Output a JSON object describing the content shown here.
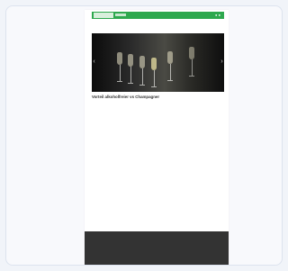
{
  "colors": {
    "page_bg": "#f1f4f9",
    "header_green": "#2ea84e",
    "footer_bg": "#333333",
    "text": "#555555"
  },
  "email": {
    "header": {
      "logo_text": "",
      "link_text": "● ●"
    },
    "hero": {
      "prev_icon": "chevron-left-icon",
      "next_icon": "chevron-right-icon",
      "prev_glyph": "‹",
      "next_glyph": "›"
    },
    "headline": "Vorteil alkoholfreier vs Champagner",
    "paragraphs": [
      "",
      "",
      "",
      "",
      "",
      "",
      ""
    ],
    "subheads": [
      "",
      "",
      "",
      ""
    ],
    "footer": {
      "left": "",
      "right": ""
    }
  }
}
